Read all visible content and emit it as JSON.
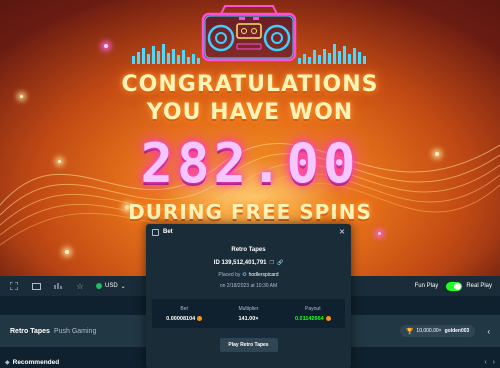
{
  "game": {
    "line1": "CONGRATULATIONS",
    "line2": "YOU HAVE WON",
    "amount": "282.00",
    "line3": "DURING FREE SPINS"
  },
  "toolbar": {
    "icons": [
      "fullscreen-icon",
      "theatre-icon",
      "stats-icon",
      "favourite-icon"
    ],
    "currency": "USD",
    "fun_play": "Fun Play",
    "real_play": "Real Play",
    "real_play_on": true
  },
  "info": {
    "game_title": "Retro Tapes",
    "provider": "Push Gaming",
    "leader_amount": "10,000.00×",
    "leader_user": "golden003"
  },
  "recommended": {
    "label": "Recommended"
  },
  "modal": {
    "title": "Bet",
    "game_name": "Retro Tapes",
    "bet_id": "ID 139,512,401,791",
    "placed_by_prefix": "Placed by",
    "placed_by_user": "hodlerspicard",
    "date": "on 2/18/2023 at 10:30 AM",
    "stats": [
      {
        "label": "Bet",
        "value": "0.00008104"
      },
      {
        "label": "Multiplier",
        "value": "141.00×"
      },
      {
        "label": "Payout",
        "value": "0.01142664"
      }
    ],
    "play_button": "Play Retro Tapes"
  },
  "colors": {
    "bg": "#0f212e",
    "panel": "#1a2c38",
    "accent_green": "#1fff20",
    "coin": "#f7931a"
  }
}
